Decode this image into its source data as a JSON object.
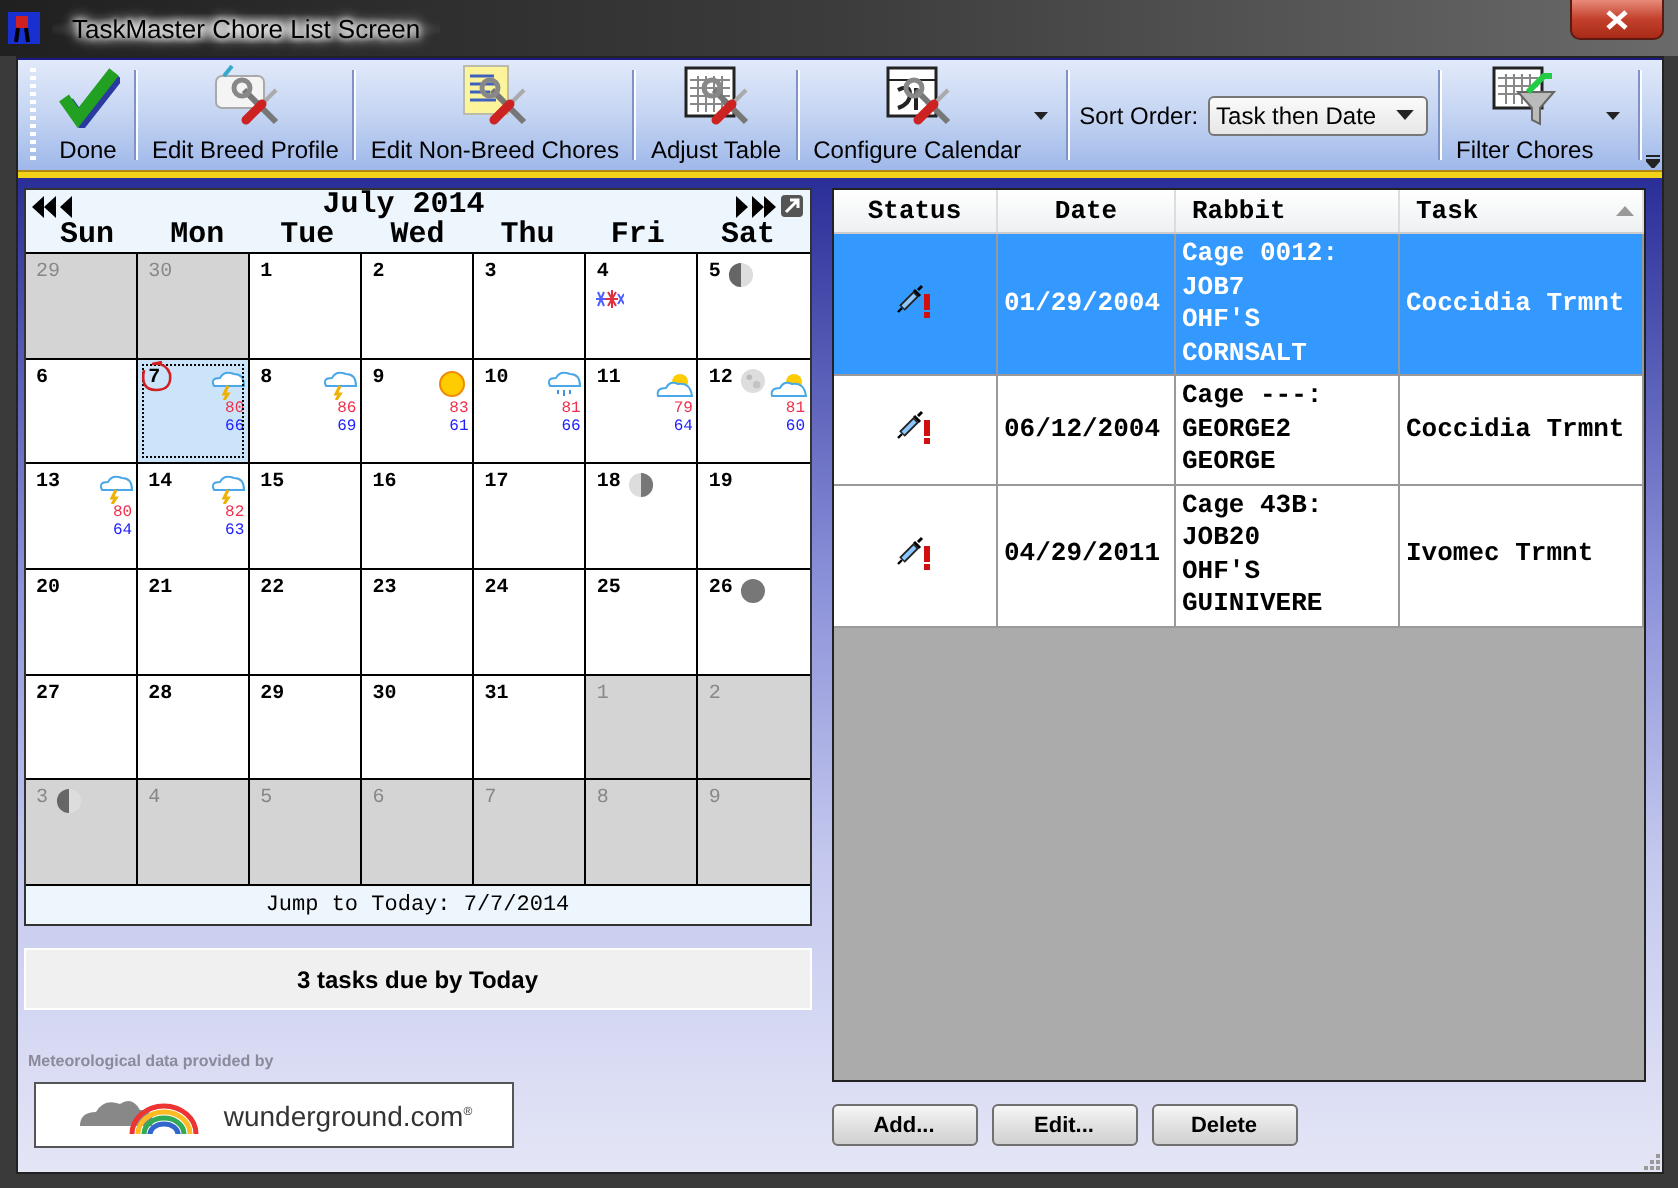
{
  "window": {
    "title": "TaskMaster Chore List Screen"
  },
  "toolbar": {
    "items": [
      {
        "kind": "done",
        "label": "Done",
        "dropdown": false
      },
      {
        "kind": "breed",
        "label": "Edit Breed Profile",
        "dropdown": false
      },
      {
        "kind": "chores",
        "label": "Edit Non-Breed Chores",
        "dropdown": false
      },
      {
        "kind": "table",
        "label": "Adjust Table",
        "dropdown": false
      },
      {
        "kind": "calendar",
        "label": "Configure Calendar",
        "dropdown": true
      },
      {
        "kind": "sort",
        "label": "Sort Order:",
        "value": "Task then Date"
      },
      {
        "kind": "filter",
        "label": "Filter Chores",
        "dropdown": true
      }
    ]
  },
  "calendar": {
    "title": "July 2014",
    "weekdays": [
      "Sun",
      "Mon",
      "Tue",
      "Wed",
      "Thu",
      "Fri",
      "Sat"
    ],
    "days": [
      {
        "day": "29",
        "other_month": true,
        "selected": false
      },
      {
        "day": "30",
        "other_month": true,
        "selected": false
      },
      {
        "day": "1",
        "other_month": false,
        "selected": false
      },
      {
        "day": "2",
        "other_month": false,
        "selected": false
      },
      {
        "day": "3",
        "other_month": false,
        "selected": false
      },
      {
        "day": "4",
        "other_month": false,
        "selected": false,
        "event": {
          "kind": "fireworks"
        }
      },
      {
        "day": "5",
        "other_month": false,
        "selected": false,
        "moon": {
          "kind": "first_quarter"
        }
      },
      {
        "day": "6",
        "other_month": false,
        "selected": false
      },
      {
        "day": "7",
        "other_month": false,
        "selected": true,
        "event": {
          "kind": "circled"
        },
        "weather": {
          "kind": "storm",
          "high": "80",
          "low": "66"
        }
      },
      {
        "day": "8",
        "other_month": false,
        "selected": false,
        "weather": {
          "kind": "storm",
          "high": "86",
          "low": "69"
        }
      },
      {
        "day": "9",
        "other_month": false,
        "selected": false,
        "weather": {
          "kind": "sun",
          "high": "83",
          "low": "61"
        }
      },
      {
        "day": "10",
        "other_month": false,
        "selected": false,
        "weather": {
          "kind": "rain",
          "high": "81",
          "low": "66"
        }
      },
      {
        "day": "11",
        "other_month": false,
        "selected": false,
        "weather": {
          "kind": "partly_cloudy",
          "high": "79",
          "low": "64"
        }
      },
      {
        "day": "12",
        "other_month": false,
        "selected": false,
        "moon": {
          "kind": "full"
        },
        "weather": {
          "kind": "partly_cloudy",
          "high": "81",
          "low": "60"
        }
      },
      {
        "day": "13",
        "other_month": false,
        "selected": false,
        "weather": {
          "kind": "storm",
          "high": "80",
          "low": "64"
        }
      },
      {
        "day": "14",
        "other_month": false,
        "selected": false,
        "weather": {
          "kind": "storm",
          "high": "82",
          "low": "63"
        }
      },
      {
        "day": "15",
        "other_month": false,
        "selected": false
      },
      {
        "day": "16",
        "other_month": false,
        "selected": false
      },
      {
        "day": "17",
        "other_month": false,
        "selected": false
      },
      {
        "day": "18",
        "other_month": false,
        "selected": false,
        "moon": {
          "kind": "last_quarter"
        }
      },
      {
        "day": "19",
        "other_month": false,
        "selected": false
      },
      {
        "day": "20",
        "other_month": false,
        "selected": false
      },
      {
        "day": "21",
        "other_month": false,
        "selected": false
      },
      {
        "day": "22",
        "other_month": false,
        "selected": false
      },
      {
        "day": "23",
        "other_month": false,
        "selected": false
      },
      {
        "day": "24",
        "other_month": false,
        "selected": false
      },
      {
        "day": "25",
        "other_month": false,
        "selected": false
      },
      {
        "day": "26",
        "other_month": false,
        "selected": false,
        "moon": {
          "kind": "new"
        }
      },
      {
        "day": "27",
        "other_month": false,
        "selected": false
      },
      {
        "day": "28",
        "other_month": false,
        "selected": false
      },
      {
        "day": "29",
        "other_month": false,
        "selected": false
      },
      {
        "day": "30",
        "other_month": false,
        "selected": false
      },
      {
        "day": "31",
        "other_month": false,
        "selected": false
      },
      {
        "day": "1",
        "other_month": true,
        "selected": false
      },
      {
        "day": "2",
        "other_month": true,
        "selected": false
      },
      {
        "day": "3",
        "other_month": true,
        "selected": false,
        "moon": {
          "kind": "first_quarter"
        }
      },
      {
        "day": "4",
        "other_month": true,
        "selected": false
      },
      {
        "day": "5",
        "other_month": true,
        "selected": false
      },
      {
        "day": "6",
        "other_month": true,
        "selected": false
      },
      {
        "day": "7",
        "other_month": true,
        "selected": false
      },
      {
        "day": "8",
        "other_month": true,
        "selected": false
      },
      {
        "day": "9",
        "other_month": true,
        "selected": false
      }
    ],
    "footer": "Jump to Today: 7/7/2014"
  },
  "summary": "3 tasks due by Today",
  "credit": {
    "text": "Meteorological data provided by",
    "logo": "wunderground.com$^{®}$"
  },
  "table": {
    "columns": [
      {
        "label": "Status",
        "sorted": false
      },
      {
        "label": "Date",
        "sorted": false
      },
      {
        "label": "Rabbit",
        "sorted": false
      },
      {
        "label": "Task",
        "sorted": true
      }
    ],
    "rows": [
      {
        "status": {
          "kind": "due"
        },
        "date": "01/29/2004",
        "rabbit": [
          "Cage 0012:",
          "JOB7",
          "OHF'S",
          "CORNSALT"
        ],
        "task": "Coccidia Trmnt",
        "selected": true
      },
      {
        "status": {
          "kind": "due"
        },
        "date": "06/12/2004",
        "rabbit": [
          "Cage ---:",
          "GEORGE2",
          "GEORGE"
        ],
        "task": "Coccidia Trmnt",
        "selected": false
      },
      {
        "status": {
          "kind": "due"
        },
        "date": "04/29/2011",
        "rabbit": [
          "Cage 43B:",
          "JOB20",
          "OHF'S",
          "GUINIVERE"
        ],
        "task": "Ivomec Trmnt",
        "selected": false
      }
    ]
  },
  "buttons": [
    "Add...",
    "Edit...",
    "Delete"
  ]
}
